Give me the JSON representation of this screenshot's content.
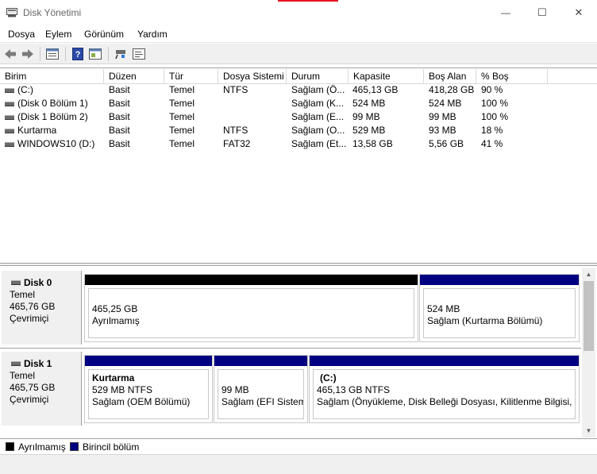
{
  "window": {
    "title": "Disk Yönetimi",
    "controls": {
      "minimize": "—",
      "maximize": "☐",
      "close": "✕"
    }
  },
  "menu": [
    "Dosya",
    "Eylem",
    "Görünüm",
    "Yardım"
  ],
  "toolbar": [
    "back-icon",
    "forward-icon",
    "properties-icon",
    "help-icon",
    "panel-icon",
    "connect-icon",
    "console-icon"
  ],
  "volume_table": {
    "columns": [
      "Birim",
      "Düzen",
      "Tür",
      "Dosya Sistemi",
      "Durum",
      "Kapasite",
      "Boş Alan",
      "% Boş"
    ],
    "rows": [
      [
        "(C:)",
        "Basit",
        "Temel",
        "NTFS",
        "Sağlam (Ö...",
        "465,13 GB",
        "418,28 GB",
        "90 %"
      ],
      [
        "(Disk 0 Bölüm 1)",
        "Basit",
        "Temel",
        "",
        "Sağlam (K...",
        "524 MB",
        "524 MB",
        "100 %"
      ],
      [
        "(Disk 1 Bölüm 2)",
        "Basit",
        "Temel",
        "",
        "Sağlam (E...",
        "99 MB",
        "99 MB",
        "100 %"
      ],
      [
        "Kurtarma",
        "Basit",
        "Temel",
        "NTFS",
        "Sağlam (O...",
        "529 MB",
        "93 MB",
        "18 %"
      ],
      [
        "WINDOWS10 (D:)",
        "Basit",
        "Temel",
        "FAT32",
        "Sağlam (Et...",
        "13,58 GB",
        "5,56 GB",
        "41 %"
      ]
    ]
  },
  "disks": [
    {
      "name": "Disk 0",
      "type": "Temel",
      "size": "465,76 GB",
      "status": "Çevrimiçi",
      "partitions": [
        {
          "title": "",
          "line1": "465,25 GB",
          "line2": "Ayrılmamış",
          "bar_color": "#000000"
        },
        {
          "title": "",
          "line1": "524 MB",
          "line2": "Sağlam (Kurtarma Bölümü)",
          "bar_color": "#000080"
        }
      ]
    },
    {
      "name": "Disk 1",
      "type": "Temel",
      "size": "465,75 GB",
      "status": "Çevrimiçi",
      "partitions": [
        {
          "title": "Kurtarma",
          "line1": "529 MB NTFS",
          "line2": "Sağlam (OEM Bölümü)",
          "bar_color": "#000080"
        },
        {
          "title": "",
          "line1": "99 MB",
          "line2": "Sağlam (EFI Sistem Bölümü)",
          "bar_color": "#000080"
        },
        {
          "title": "(C:)",
          "line1": "465,13 GB NTFS",
          "line2": "Sağlam (Önyükleme, Disk Belleği Dosyası, Kilitlenme Bilgisi, Birincil Bölüm)",
          "bar_color": "#000080"
        }
      ]
    }
  ],
  "legend": [
    {
      "label": "Ayrılmamış",
      "color": "#000000"
    },
    {
      "label": "Birincil bölüm",
      "color": "#000080"
    }
  ],
  "scrollbar": {
    "up": "▲",
    "down": "▼"
  }
}
